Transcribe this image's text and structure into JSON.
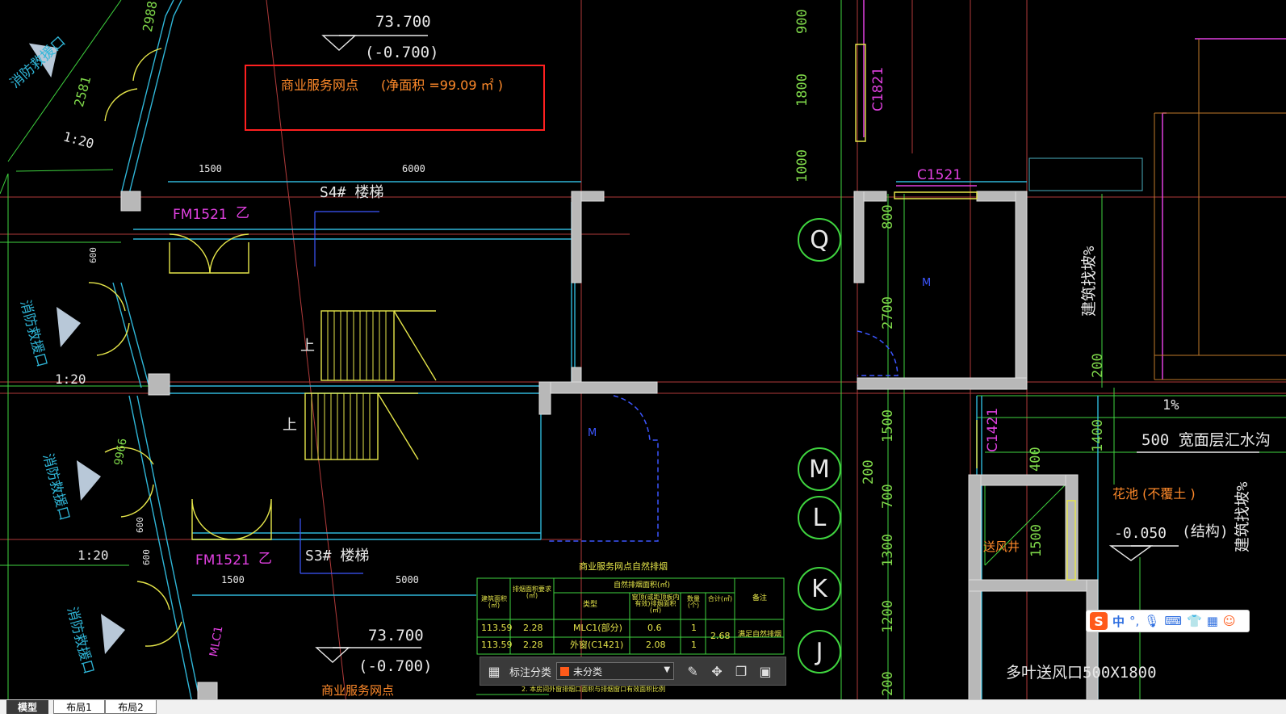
{
  "drawing": {
    "elev_top_value": "73.700",
    "elev_top_sub": "(-0.700)",
    "elev_bottom_value": "73.700",
    "elev_bottom_sub": "(-0.700)",
    "highlight_title": "商业服务网点",
    "highlight_area": "(净面积    =99.09 ㎡ )",
    "dim_1500_top": "1500",
    "dim_6000": "6000",
    "dim_1500_bottom": "1500",
    "dim_5000": "5000",
    "dim_900": "900",
    "dim_1800": "1800",
    "dim_1000": "1000",
    "dim_800": "800",
    "dim_2700": "2700",
    "dim_200_r": "200",
    "dim_1400": "1400",
    "dim_400": "400",
    "dim_1500_v": "1500",
    "dim_200_v": "200",
    "dim_700": "700",
    "dim_1300": "1300",
    "dim_1200": "1200",
    "dim_200_b": "200",
    "dim_1500_r": "1500",
    "dim_2581": "2581",
    "dim_9966": "9966",
    "dim_2988": "2988",
    "door_fm_top": "FM1521",
    "door_fm_top_grade": "乙",
    "door_fm_bottom": "FM1521",
    "door_fm_bottom_grade": "乙",
    "stair_s4": "S4#  楼梯",
    "stair_s3": "S3#  楼梯",
    "stair_up_1": "上",
    "stair_up_2": "上",
    "window_c1821": "C1821",
    "window_c1521": "C1521",
    "window_c1421": "C1421",
    "window_mlc1": "MLC1",
    "slope_1": "1:20",
    "slope_2": "1:20",
    "slope_3": "1:20",
    "fire_ent_1": "消防救援口",
    "fire_ent_2": "消防救援口",
    "fire_ent_3": "消防救援口",
    "fire_ent_4": "消防救援口",
    "axis_q": "Q",
    "axis_m": "M",
    "axis_l": "L",
    "axis_k": "K",
    "axis_j": "J",
    "percent": "1%",
    "gutter": "500  宽面层汇水沟",
    "slope_text_1": "建筑找坡%",
    "slope_text_2": "建筑找坡%",
    "planter": "花池  (不覆土    )",
    "elev_planter": "-0.050",
    "elev_planter_note": "(结构)",
    "vent_shaft": "送风井",
    "vent_outlet": "多叶送风口500X1800",
    "window_600_a": "600",
    "window_600_b": "600",
    "window_600_c": "600",
    "bottom_label": "商业服务网点",
    "door_tag_1": "M",
    "door_tag_2": "M"
  },
  "table": {
    "title": "商业服务网点自然排烟",
    "headers": [
      "建筑面积(㎡)",
      "排烟面积要求(㎡)",
      "自然排烟面积(㎡)",
      "类型",
      "窗顶(或距顶板内有效)排烟面积(㎡)",
      "数量(个)",
      "合计(㎡)",
      "备注"
    ],
    "rows": [
      [
        "113.59",
        "2.28",
        "MLC1(部分)",
        "0.6",
        "1",
        "2.68",
        "满足自然排烟"
      ],
      [
        "113.59",
        "2.28",
        "外窗(C1421)",
        "2.08",
        "1",
        "",
        ""
      ]
    ],
    "footnote": "2. 本房间外窗排烟口面积与排烟窗口有效面积比例"
  },
  "anno_toolbar": {
    "label": "标注分类",
    "selected": "未分类",
    "swatch_color": "#ff5a1a"
  },
  "ime": {
    "logo": "S",
    "mode": "中"
  },
  "tabs": [
    {
      "label": "模型",
      "active": true
    },
    {
      "label": "布局1",
      "active": false
    },
    {
      "label": "布局2",
      "active": false
    }
  ]
}
